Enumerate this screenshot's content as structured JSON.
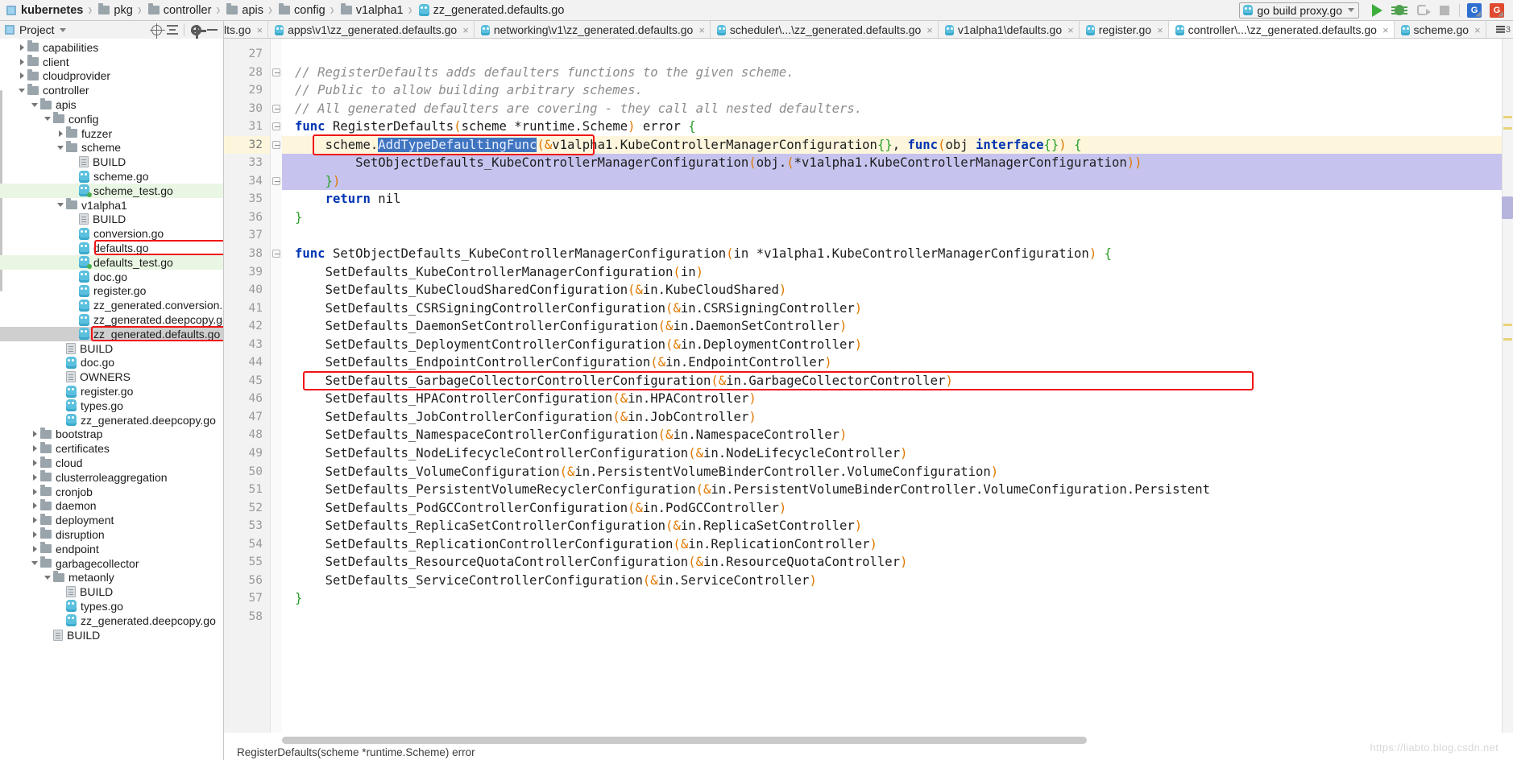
{
  "breadcrumb": {
    "items": [
      {
        "label": "kubernetes",
        "icon": "project-icon",
        "root": true
      },
      {
        "label": "pkg",
        "icon": "folder-icon"
      },
      {
        "label": "controller",
        "icon": "folder-icon"
      },
      {
        "label": "apis",
        "icon": "folder-icon"
      },
      {
        "label": "config",
        "icon": "folder-icon"
      },
      {
        "label": "v1alpha1",
        "icon": "folder-icon"
      },
      {
        "label": "zz_generated.defaults.go",
        "icon": "go-file-icon"
      }
    ],
    "separator": "›"
  },
  "toolbar": {
    "run_config_label": "go build proxy.go",
    "run_icon": "run-icon",
    "debug_icon": "debug-icon",
    "attach_icon": "attach-debugger-icon",
    "stop_icon": "stop-icon",
    "badge_blue": "G",
    "badge_red": "G"
  },
  "project_panel": {
    "title": "Project",
    "locate_icon": "locate-target-icon",
    "collapse_icon": "collapse-all-icon",
    "settings_icon": "gear-icon",
    "hide_icon": "hide-panel-icon"
  },
  "tabs": {
    "items": [
      {
        "label": "lts.go",
        "icon": "go-file-icon",
        "active": false,
        "clipped": true
      },
      {
        "label": "apps\\v1\\zz_generated.defaults.go",
        "icon": "go-file-icon",
        "active": false
      },
      {
        "label": "networking\\v1\\zz_generated.defaults.go",
        "icon": "go-file-icon",
        "active": false
      },
      {
        "label": "scheduler\\...\\zz_generated.defaults.go",
        "icon": "go-file-icon",
        "active": false
      },
      {
        "label": "v1alpha1\\defaults.go",
        "icon": "go-file-icon",
        "active": false
      },
      {
        "label": "register.go",
        "icon": "go-file-icon",
        "active": false
      },
      {
        "label": "controller\\...\\zz_generated.defaults.go",
        "icon": "go-file-icon",
        "active": true
      },
      {
        "label": "scheme.go",
        "icon": "go-file-icon",
        "active": false
      }
    ],
    "close_glyph": "×",
    "overflow_label": "3",
    "overflow_icon": "tab-list-icon"
  },
  "tree": {
    "nodes": [
      {
        "label": "capabilities",
        "indent": 2,
        "icon": "folder-icon",
        "arrow": "right"
      },
      {
        "label": "client",
        "indent": 2,
        "icon": "folder-icon",
        "arrow": "right"
      },
      {
        "label": "cloudprovider",
        "indent": 2,
        "icon": "folder-icon",
        "arrow": "right"
      },
      {
        "label": "controller",
        "indent": 2,
        "icon": "folder-icon",
        "arrow": "down"
      },
      {
        "label": "apis",
        "indent": 3,
        "icon": "folder-icon",
        "arrow": "down"
      },
      {
        "label": "config",
        "indent": 4,
        "icon": "folder-icon",
        "arrow": "down"
      },
      {
        "label": "fuzzer",
        "indent": 5,
        "icon": "folder-icon",
        "arrow": "right"
      },
      {
        "label": "scheme",
        "indent": 5,
        "icon": "folder-icon",
        "arrow": "down"
      },
      {
        "label": "BUILD",
        "indent": 6,
        "icon": "text-file-icon",
        "arrow": "none"
      },
      {
        "label": "scheme.go",
        "indent": 6,
        "icon": "go-file-icon",
        "arrow": "none"
      },
      {
        "label": "scheme_test.go",
        "indent": 6,
        "icon": "go-test-file-icon",
        "arrow": "none",
        "highlight": "green"
      },
      {
        "label": "v1alpha1",
        "indent": 5,
        "icon": "folder-icon",
        "arrow": "down"
      },
      {
        "label": "BUILD",
        "indent": 6,
        "icon": "text-file-icon",
        "arrow": "none"
      },
      {
        "label": "conversion.go",
        "indent": 6,
        "icon": "go-file-icon",
        "arrow": "none"
      },
      {
        "label": "defaults.go",
        "indent": 6,
        "icon": "go-file-icon",
        "arrow": "none",
        "boxed": true
      },
      {
        "label": "defaults_test.go",
        "indent": 6,
        "icon": "go-test-file-icon",
        "arrow": "none",
        "highlight": "green"
      },
      {
        "label": "doc.go",
        "indent": 6,
        "icon": "go-file-icon",
        "arrow": "none"
      },
      {
        "label": "register.go",
        "indent": 6,
        "icon": "go-file-icon",
        "arrow": "none"
      },
      {
        "label": "zz_generated.conversion.go",
        "indent": 6,
        "icon": "go-file-icon",
        "arrow": "none"
      },
      {
        "label": "zz_generated.deepcopy.go",
        "indent": 6,
        "icon": "go-file-icon",
        "arrow": "none"
      },
      {
        "label": "zz_generated.defaults.go",
        "indent": 6,
        "icon": "go-file-icon",
        "arrow": "none",
        "highlight": "selected",
        "boxed": true
      },
      {
        "label": "BUILD",
        "indent": 5,
        "icon": "text-file-icon",
        "arrow": "none"
      },
      {
        "label": "doc.go",
        "indent": 5,
        "icon": "go-file-icon",
        "arrow": "none"
      },
      {
        "label": "OWNERS",
        "indent": 5,
        "icon": "text-file-icon",
        "arrow": "none"
      },
      {
        "label": "register.go",
        "indent": 5,
        "icon": "go-file-icon",
        "arrow": "none"
      },
      {
        "label": "types.go",
        "indent": 5,
        "icon": "go-file-icon",
        "arrow": "none"
      },
      {
        "label": "zz_generated.deepcopy.go",
        "indent": 5,
        "icon": "go-file-icon",
        "arrow": "none"
      },
      {
        "label": "bootstrap",
        "indent": 3,
        "icon": "folder-icon",
        "arrow": "right"
      },
      {
        "label": "certificates",
        "indent": 3,
        "icon": "folder-icon",
        "arrow": "right"
      },
      {
        "label": "cloud",
        "indent": 3,
        "icon": "folder-icon",
        "arrow": "right"
      },
      {
        "label": "clusterroleaggregation",
        "indent": 3,
        "icon": "folder-icon",
        "arrow": "right"
      },
      {
        "label": "cronjob",
        "indent": 3,
        "icon": "folder-icon",
        "arrow": "right"
      },
      {
        "label": "daemon",
        "indent": 3,
        "icon": "folder-icon",
        "arrow": "right"
      },
      {
        "label": "deployment",
        "indent": 3,
        "icon": "folder-icon",
        "arrow": "right"
      },
      {
        "label": "disruption",
        "indent": 3,
        "icon": "folder-icon",
        "arrow": "right"
      },
      {
        "label": "endpoint",
        "indent": 3,
        "icon": "folder-icon",
        "arrow": "right"
      },
      {
        "label": "garbagecollector",
        "indent": 3,
        "icon": "folder-icon",
        "arrow": "down"
      },
      {
        "label": "metaonly",
        "indent": 4,
        "icon": "folder-icon",
        "arrow": "down"
      },
      {
        "label": "BUILD",
        "indent": 5,
        "icon": "text-file-icon",
        "arrow": "none"
      },
      {
        "label": "types.go",
        "indent": 5,
        "icon": "go-file-icon",
        "arrow": "none"
      },
      {
        "label": "zz_generated.deepcopy.go",
        "indent": 5,
        "icon": "go-file-icon",
        "arrow": "none"
      },
      {
        "label": "BUILD",
        "indent": 4,
        "icon": "text-file-icon",
        "arrow": "none"
      }
    ]
  },
  "editor": {
    "first_line": 27,
    "current_line": 32,
    "selected_token": "AddTypeDefaultingFunc",
    "lines": [
      {
        "n": 27,
        "text": ""
      },
      {
        "n": 28,
        "text": "// RegisterDefaults adds defaulters functions to the given scheme.",
        "style": "comment",
        "fold": "start"
      },
      {
        "n": 29,
        "text": "// Public to allow building arbitrary schemes.",
        "style": "comment"
      },
      {
        "n": 30,
        "text": "// All generated defaulters are covering - they call all nested defaulters.",
        "style": "comment",
        "fold": "start"
      },
      {
        "n": 31,
        "text": "func RegisterDefaults(scheme *runtime.Scheme) error {",
        "style": "code",
        "fold": "start"
      },
      {
        "n": 32,
        "text": "    scheme.AddTypeDefaultingFunc(&v1alpha1.KubeControllerManagerConfiguration{}, func(obj interface{}) {",
        "style": "code",
        "fold": "start",
        "current": true,
        "selected": true,
        "boxed": true
      },
      {
        "n": 33,
        "text": "        SetObjectDefaults_KubeControllerManagerConfiguration(obj.(*v1alpha1.KubeControllerManagerConfiguration))",
        "style": "code",
        "selected": true
      },
      {
        "n": 34,
        "text": "    })",
        "style": "code",
        "fold": "end",
        "selected": true
      },
      {
        "n": 35,
        "text": "    return nil",
        "style": "code"
      },
      {
        "n": 36,
        "text": "}",
        "style": "code"
      },
      {
        "n": 37,
        "text": ""
      },
      {
        "n": 38,
        "text": "func SetObjectDefaults_KubeControllerManagerConfiguration(in *v1alpha1.KubeControllerManagerConfiguration) {",
        "style": "code",
        "fold": "start"
      },
      {
        "n": 39,
        "text": "    SetDefaults_KubeControllerManagerConfiguration(in)",
        "style": "code"
      },
      {
        "n": 40,
        "text": "    SetDefaults_KubeCloudSharedConfiguration(&in.KubeCloudShared)",
        "style": "code"
      },
      {
        "n": 41,
        "text": "    SetDefaults_CSRSigningControllerConfiguration(&in.CSRSigningController)",
        "style": "code"
      },
      {
        "n": 42,
        "text": "    SetDefaults_DaemonSetControllerConfiguration(&in.DaemonSetController)",
        "style": "code"
      },
      {
        "n": 43,
        "text": "    SetDefaults_DeploymentControllerConfiguration(&in.DeploymentController)",
        "style": "code"
      },
      {
        "n": 44,
        "text": "    SetDefaults_EndpointControllerConfiguration(&in.EndpointController)",
        "style": "code"
      },
      {
        "n": 45,
        "text": "    SetDefaults_GarbageCollectorControllerConfiguration(&in.GarbageCollectorController)",
        "style": "code",
        "boxed": true
      },
      {
        "n": 46,
        "text": "    SetDefaults_HPAControllerConfiguration(&in.HPAController)",
        "style": "code"
      },
      {
        "n": 47,
        "text": "    SetDefaults_JobControllerConfiguration(&in.JobController)",
        "style": "code"
      },
      {
        "n": 48,
        "text": "    SetDefaults_NamespaceControllerConfiguration(&in.NamespaceController)",
        "style": "code"
      },
      {
        "n": 49,
        "text": "    SetDefaults_NodeLifecycleControllerConfiguration(&in.NodeLifecycleController)",
        "style": "code"
      },
      {
        "n": 50,
        "text": "    SetDefaults_VolumeConfiguration(&in.PersistentVolumeBinderController.VolumeConfiguration)",
        "style": "code"
      },
      {
        "n": 51,
        "text": "    SetDefaults_PersistentVolumeRecyclerConfiguration(&in.PersistentVolumeBinderController.VolumeConfiguration.Persistent",
        "style": "code"
      },
      {
        "n": 52,
        "text": "    SetDefaults_PodGCControllerConfiguration(&in.PodGCController)",
        "style": "code"
      },
      {
        "n": 53,
        "text": "    SetDefaults_ReplicaSetControllerConfiguration(&in.ReplicaSetController)",
        "style": "code"
      },
      {
        "n": 54,
        "text": "    SetDefaults_ReplicationControllerConfiguration(&in.ReplicationController)",
        "style": "code"
      },
      {
        "n": 55,
        "text": "    SetDefaults_ResourceQuotaControllerConfiguration(&in.ResourceQuotaController)",
        "style": "code"
      },
      {
        "n": 56,
        "text": "    SetDefaults_ServiceControllerConfiguration(&in.ServiceController)",
        "style": "code"
      },
      {
        "n": 57,
        "text": "}",
        "style": "code"
      },
      {
        "n": 58,
        "text": ""
      }
    ]
  },
  "status_bar": {
    "breadcrumb_text": "RegisterDefaults(scheme *runtime.Scheme) error"
  },
  "watermark": {
    "text": "https://liabto.blog.csdn.net"
  },
  "colors": {
    "accent_red_box": "#f01414",
    "selection_blue": "#3f74c1",
    "selection_row": "#c6c4ef",
    "current_line": "#fdf6dd",
    "green_row": "#eaf6e4",
    "keyword": "#0033b3",
    "comment": "#8c8c8c",
    "paren": "#e07800"
  }
}
